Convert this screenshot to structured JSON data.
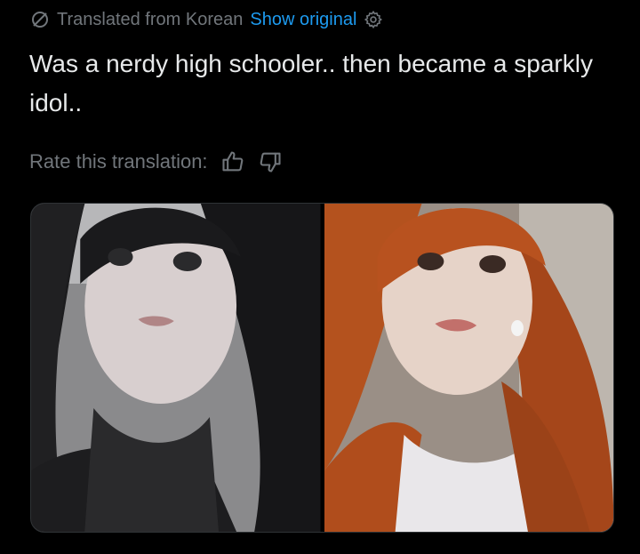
{
  "translation_bar": {
    "label": "Translated from Korean",
    "link": "Show original",
    "icons": [
      "globe-slash-icon",
      "gear-icon"
    ]
  },
  "tweet": {
    "text": "Was a nerdy high schooler.. then became a sparkly idol.."
  },
  "rating": {
    "label": "Rate this translation:",
    "icons": [
      "thumbs-up-icon",
      "thumbs-down-icon"
    ]
  },
  "media": {
    "photos": [
      {
        "name": "photo-left",
        "content": "portrait with long black hair"
      },
      {
        "name": "photo-right",
        "content": "portrait with long orange hair"
      }
    ]
  },
  "colors": {
    "background": "#000000",
    "text": "#e7e9ea",
    "muted": "#71767b",
    "link": "#1d9bf0",
    "border": "#2f3336"
  }
}
